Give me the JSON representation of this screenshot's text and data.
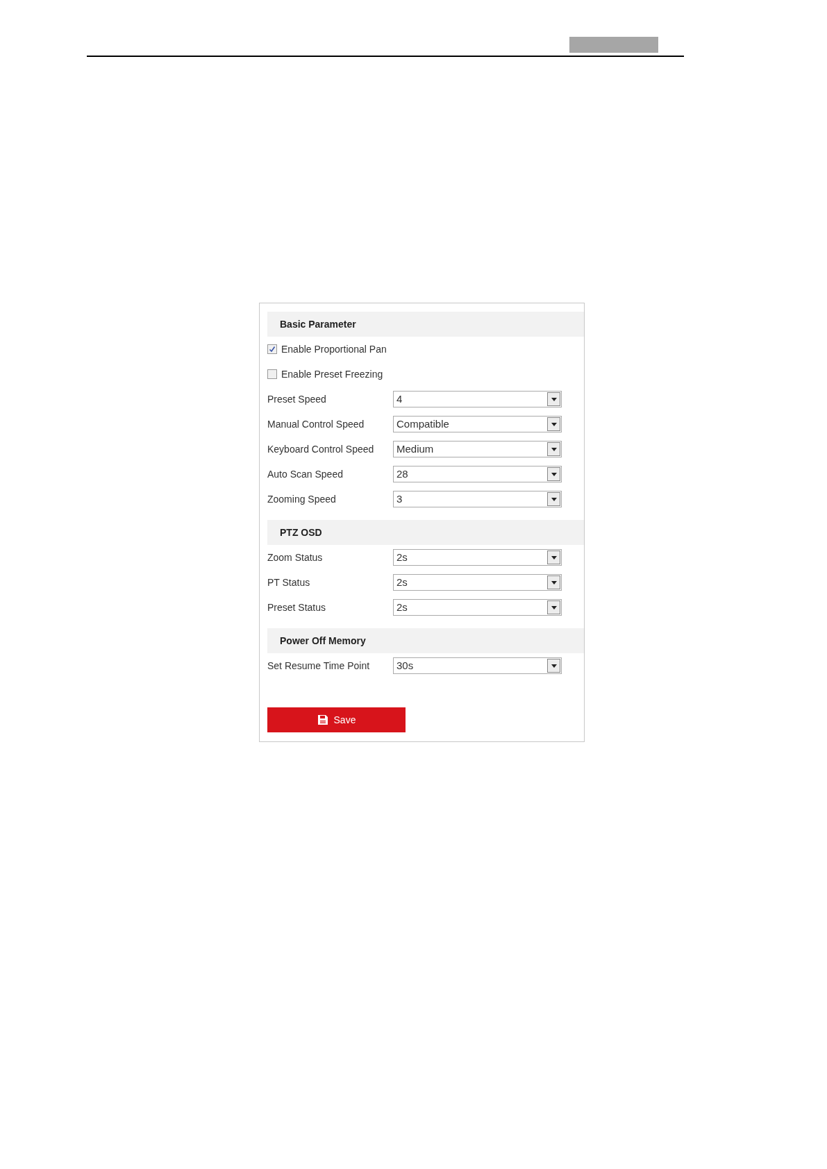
{
  "sections": [
    {
      "title": "Basic Parameter",
      "items": [
        {
          "kind": "checkbox",
          "label": "Enable Proportional Pan",
          "checked": true
        },
        {
          "kind": "checkbox",
          "label": "Enable Preset Freezing",
          "checked": false
        },
        {
          "kind": "select",
          "label": "Preset Speed",
          "value": "4"
        },
        {
          "kind": "select",
          "label": "Manual Control Speed",
          "value": "Compatible"
        },
        {
          "kind": "select",
          "label": "Keyboard Control Speed",
          "value": "Medium"
        },
        {
          "kind": "select",
          "label": "Auto Scan Speed",
          "value": "28"
        },
        {
          "kind": "select",
          "label": "Zooming Speed",
          "value": "3"
        }
      ]
    },
    {
      "title": "PTZ OSD",
      "items": [
        {
          "kind": "select",
          "label": "Zoom Status",
          "value": "2s"
        },
        {
          "kind": "select",
          "label": "PT Status",
          "value": "2s"
        },
        {
          "kind": "select",
          "label": "Preset Status",
          "value": "2s"
        }
      ]
    },
    {
      "title": "Power Off Memory",
      "items": [
        {
          "kind": "select",
          "label": "Set Resume Time Point",
          "value": "30s"
        }
      ]
    }
  ],
  "save_button": "Save"
}
